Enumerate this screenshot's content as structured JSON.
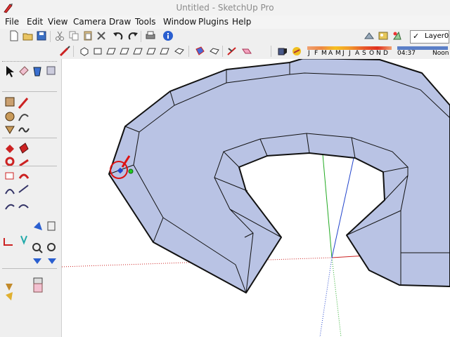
{
  "window": {
    "title": "Untitled - SketchUp Pro"
  },
  "menu": [
    "File",
    "Edit",
    "View",
    "Camera",
    "Draw",
    "Tools",
    "Window",
    "Plugins",
    "Help"
  ],
  "layer": {
    "checked": "✓",
    "name": "Layer0"
  },
  "shadow": {
    "months": [
      "J",
      "F",
      "M",
      "A",
      "M",
      "J",
      "J",
      "A",
      "S",
      "O",
      "N",
      "D"
    ],
    "time_start": "04:37",
    "time_noon": "Noon"
  },
  "colors": {
    "face": "#b9c3e4",
    "edge": "#111111",
    "axis_red": "#cc2222",
    "axis_green": "#22aa22",
    "axis_blue": "#2244cc",
    "cursor": "#dd1111"
  },
  "icons": {
    "toolbar_top": [
      "new-file-icon",
      "open-icon",
      "save-icon",
      "cut-icon",
      "copy-icon",
      "paste-icon",
      "erase-icon",
      "undo-icon",
      "redo-icon",
      "print-icon",
      "model-info-icon"
    ],
    "toolbar_right": [
      "sandbox-icon",
      "photo-textures-icon",
      "add-location-icon",
      "toggle-terrain-icon"
    ],
    "toolbar_second": [
      "section-plane-icon",
      "iso-view-icon",
      "top-view-icon",
      "front-view-icon",
      "right-view-icon",
      "back-view-icon",
      "left-view-icon",
      "bottom-view-icon",
      "xray-icon",
      "wireframe-icon",
      "hidden-line-icon",
      "shaded-icon",
      "shaded-texture-icon",
      "monochrome-icon",
      "shadows-icon",
      "fog-icon"
    ],
    "left_tools": [
      "select-icon",
      "eraser-icon",
      "paint-bucket-icon",
      "component-icon",
      "rectangle-icon",
      "line-icon",
      "circle-icon",
      "arc-icon",
      "polygon-icon",
      "freehand-icon",
      "move-icon",
      "pushpull-icon",
      "rotate-icon",
      "followme-icon",
      "scale-icon",
      "offset-icon",
      "tape-measure-icon",
      "dimension-icon",
      "protractor-icon",
      "text-icon",
      "axes-icon",
      "3d-text-icon",
      "orbit-icon",
      "pan-icon",
      "zoom-icon",
      "zoom-window-icon",
      "zoom-extents-icon",
      "previous-view-icon",
      "position-camera-icon",
      "walk-icon",
      "look-around-icon",
      "section-icon"
    ]
  }
}
